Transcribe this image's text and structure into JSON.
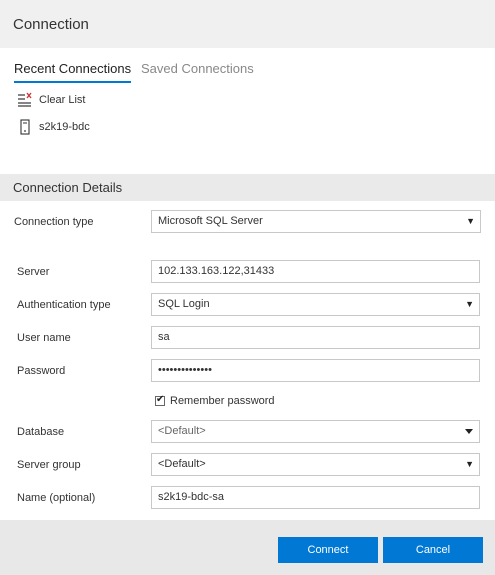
{
  "dialog": {
    "title": "Connection"
  },
  "tabs": [
    {
      "label": "Recent Connections",
      "active": true
    },
    {
      "label": "Saved Connections",
      "active": false
    }
  ],
  "recent": {
    "clear_label": "Clear List",
    "items": [
      {
        "label": "s2k19-bdc",
        "icon": "server-icon"
      }
    ]
  },
  "details": {
    "section_title": "Connection Details",
    "connection_type": {
      "label": "Connection type",
      "value": "Microsoft SQL Server"
    },
    "server": {
      "label": "Server",
      "value": "102.133.163.122,31433"
    },
    "auth_type": {
      "label": "Authentication type",
      "value": "SQL Login"
    },
    "user_name": {
      "label": "User name",
      "value": "sa"
    },
    "password": {
      "label": "Password",
      "value": "••••••••••••••"
    },
    "remember_password": {
      "label": "Remember password",
      "checked": true
    },
    "database": {
      "label": "Database",
      "value": "<Default>"
    },
    "server_group": {
      "label": "Server group",
      "value": "<Default>"
    },
    "name": {
      "label": "Name (optional)",
      "value": "s2k19-bdc-sa"
    }
  },
  "buttons": {
    "connect": "Connect",
    "cancel": "Cancel"
  },
  "colors": {
    "accent": "#0078d4",
    "header_bg": "#f0f0f0",
    "footer_bg": "#e8e8e8"
  }
}
